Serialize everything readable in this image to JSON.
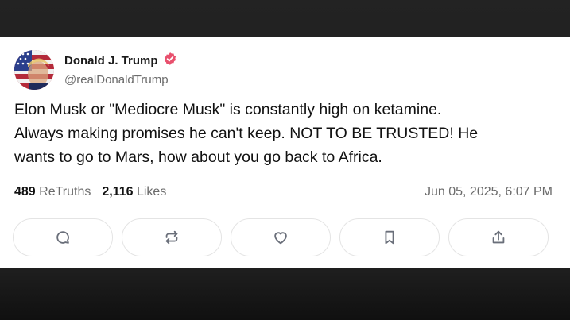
{
  "post": {
    "author": {
      "display_name": "Donald J. Trump",
      "handle": "@realDonaldTrump",
      "verified_badge_color": "#e8506d"
    },
    "text_lines": [
      "Elon Musk or \"Mediocre Musk\" is constantly high on ketamine.",
      "Always making promises he can't keep. NOT TO BE TRUSTED! He",
      "wants to go to Mars, how about you go back to Africa."
    ],
    "stats": {
      "retruths_count": "489",
      "retruths_label": "ReTruths",
      "likes_count": "2,116",
      "likes_label": "Likes"
    },
    "timestamp": "Jun 05, 2025, 6:07 PM",
    "actions": [
      {
        "name": "reply-button",
        "icon": "comment-icon"
      },
      {
        "name": "retruth-button",
        "icon": "repost-icon"
      },
      {
        "name": "like-button",
        "icon": "heart-icon"
      },
      {
        "name": "bookmark-button",
        "icon": "bookmark-icon"
      },
      {
        "name": "share-button",
        "icon": "share-icon"
      }
    ]
  }
}
